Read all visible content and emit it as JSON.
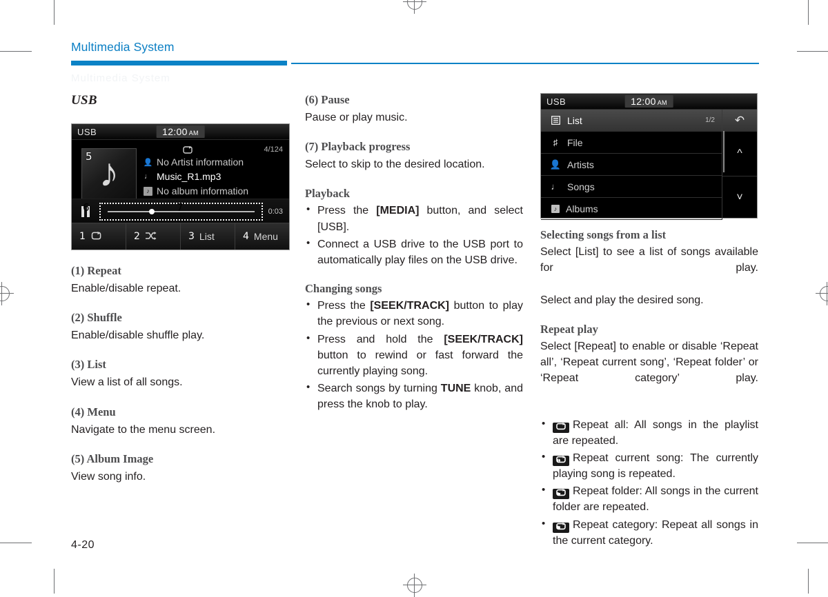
{
  "page": {
    "running_head": "Multimedia System",
    "folio": "4-20",
    "accent_color": "#0b82c6",
    "ghost_text": "Multimedia System"
  },
  "col1": {
    "section_title": "USB",
    "player": {
      "source": "USB",
      "clock_time": "12:00",
      "clock_ampm": "AM",
      "track_count": "4/124",
      "repeat_icon": "repeat-icon",
      "album_art_icon": "music-note-icon",
      "callouts": {
        "album": "5",
        "pause": "6",
        "progress": "7"
      },
      "info_lines": [
        {
          "icon": "artist-icon",
          "text": "No Artist information"
        },
        {
          "icon": "song-icon",
          "text": "Music_R1.mp3"
        },
        {
          "icon": "album-icon",
          "text": "No album information"
        }
      ],
      "elapsed_time": "0:03",
      "buttons": [
        {
          "num": "1",
          "icon": "repeat-icon",
          "label": ""
        },
        {
          "num": "2",
          "icon": "shuffle-icon",
          "label": ""
        },
        {
          "num": "3",
          "icon": "",
          "label": "List"
        },
        {
          "num": "4",
          "icon": "",
          "label": "Menu"
        }
      ]
    },
    "entries": [
      {
        "heading": "(1) Repeat",
        "text": "Enable/disable repeat."
      },
      {
        "heading": "(2) Shuffle",
        "text": "Enable/disable shuffle play."
      },
      {
        "heading": "(3) List",
        "text": "View a list of all songs."
      },
      {
        "heading": "(4) Menu",
        "text": "Navigate to the menu screen."
      },
      {
        "heading": "(5) Album Image",
        "text": "View song info."
      }
    ]
  },
  "col2": {
    "entries": [
      {
        "heading": "(6) Pause",
        "text": "Pause or play music."
      },
      {
        "heading": "(7) Playback progress",
        "text": "Select to skip to the desired location."
      }
    ],
    "playback": {
      "heading": "Playback",
      "bullets": [
        {
          "pre": "Press the ",
          "bold": "[MEDIA]",
          "post": " button, and select [USB]."
        },
        {
          "pre": "Connect a USB drive to the USB port to automatically play files on the USB drive.",
          "bold": "",
          "post": ""
        }
      ]
    },
    "changing": {
      "heading": "Changing songs",
      "bullets": [
        {
          "pre": "Press the ",
          "bold": "[SEEK/TRACK]",
          "post": " button to play the previous or next song."
        },
        {
          "pre": "Press and hold the ",
          "bold": "[SEEK/TRACK]",
          "post": " button to rewind or fast forward the currently playing song."
        },
        {
          "pre": "Search songs by turning ",
          "bold": "TUNE",
          "post": " knob, and press the knob to play."
        }
      ]
    }
  },
  "col3": {
    "list_screen": {
      "source": "USB",
      "clock_time": "12:00",
      "clock_ampm": "AM",
      "header_label": "List",
      "header_icon": "list-icon",
      "page_indicator": "1/2",
      "rows": [
        {
          "icon": "music-note-icon",
          "label": "File"
        },
        {
          "icon": "artist-icon",
          "label": "Artists"
        },
        {
          "icon": "song-icon",
          "label": "Songs"
        },
        {
          "icon": "album-icon",
          "label": "Albums"
        }
      ],
      "side_buttons": [
        {
          "icon": "back-icon",
          "label": ""
        },
        {
          "icon": "chevron-up-icon",
          "label": ""
        },
        {
          "icon": "chevron-down-icon",
          "label": ""
        }
      ]
    },
    "selecting": {
      "heading": "Selecting songs from a list",
      "para1": "Select [List] to see a list of songs available for play.",
      "para2": "Select and play the desired song."
    },
    "repeat": {
      "heading": "Repeat play",
      "intro": "Select [Repeat] to enable or disable ‘Repeat all’, ‘Repeat current song’, ‘Repeat folder’ or ‘Repeat category’ play.",
      "bullets": [
        {
          "icon": "repeat-all-icon",
          "text": "Repeat all: All songs in the playlist are repeated."
        },
        {
          "icon": "repeat-one-icon",
          "text": "Repeat current song: The currently playing song is repeated."
        },
        {
          "icon": "repeat-folder-icon",
          "text": "Repeat folder: All songs in the current folder are repeated."
        },
        {
          "icon": "repeat-category-icon",
          "text": "Repeat category: Repeat all songs in the current category."
        }
      ]
    }
  }
}
